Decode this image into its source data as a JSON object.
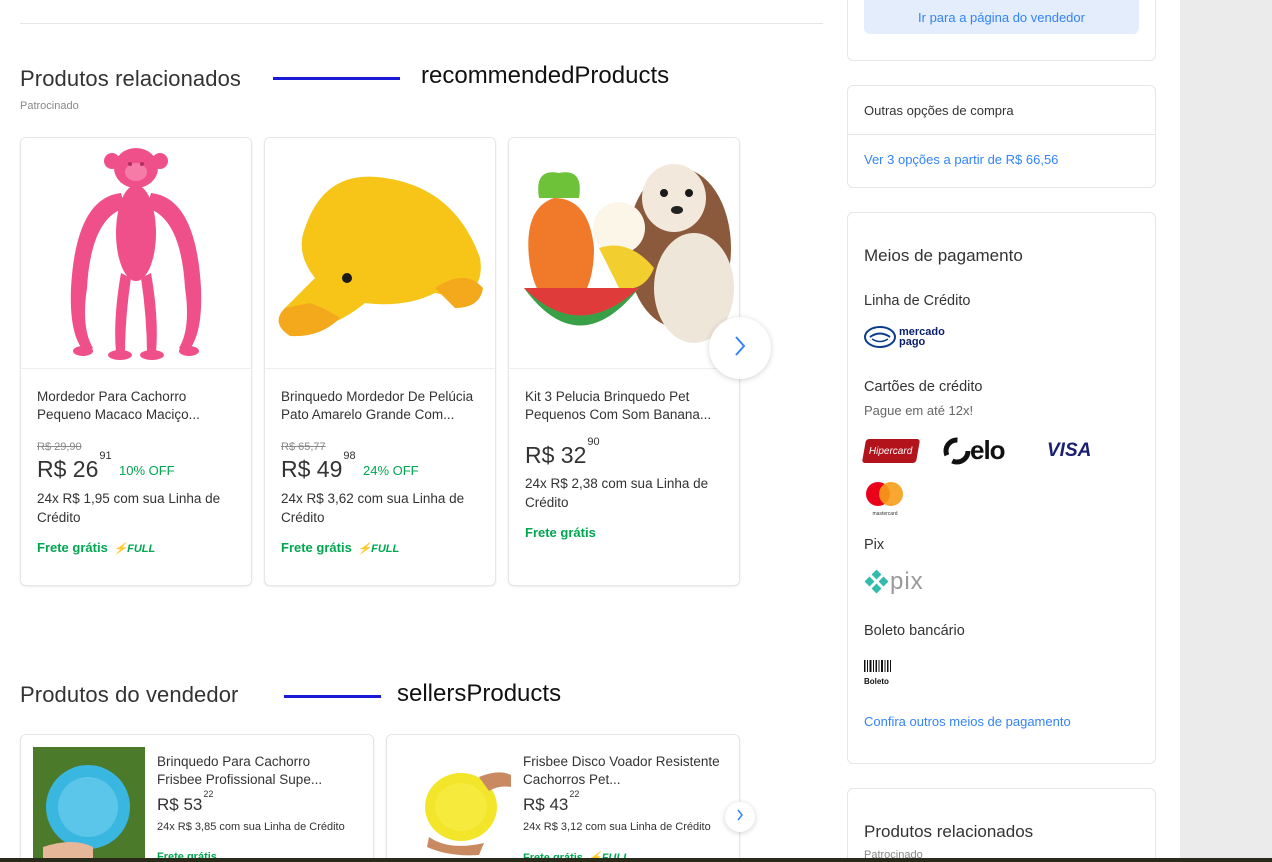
{
  "recommended": {
    "title": "Produtos relacionados",
    "sponsored": "Patrocinado",
    "annotation": "recommendedProducts",
    "cards": [
      {
        "title": "Mordedor Para Cachorro Pequeno Macaco Maciço...",
        "old_price": "R$ 29,90",
        "price_int": "R$ 26",
        "price_cents": "91",
        "discount": "10% OFF",
        "installments": "24x R$ 1,95 com sua Linha de Crédito",
        "shipping": "Frete grátis",
        "full": "FULL"
      },
      {
        "title": "Brinquedo Mordedor De Pelúcia Pato Amarelo Grande Com...",
        "old_price": "R$ 65,77",
        "price_int": "R$ 49",
        "price_cents": "98",
        "discount": "24% OFF",
        "installments": "24x R$ 3,62 com sua Linha de Crédito",
        "shipping": "Frete grátis",
        "full": "FULL"
      },
      {
        "title": "Kit 3 Pelucia Brinquedo Pet Pequenos Com Som Banana...",
        "price_int": "R$ 32",
        "price_cents": "90",
        "installments": "24x R$ 2,38 com sua Linha de Crédito",
        "shipping": "Frete grátis"
      }
    ]
  },
  "seller": {
    "title": "Produtos do vendedor",
    "annotation": "sellersProducts",
    "cards": [
      {
        "title": "Brinquedo Para Cachorro Frisbee Profissional Supe...",
        "price_int": "R$ 53",
        "price_cents": "22",
        "installments": "24x R$ 3,85 com sua Linha de Crédito",
        "shipping": "Frete grátis"
      },
      {
        "title": "Frisbee Disco Voador Resistente Cachorros Pet...",
        "price_int": "R$ 43",
        "price_cents": "22",
        "installments": "24x R$ 3,12 com sua Linha de Crédito",
        "shipping": "Frete grátis",
        "full": "FULL"
      }
    ]
  },
  "sidebar": {
    "seller_button": "Ir para a página do vendedor",
    "other_options": {
      "title": "Outras opções de compra",
      "link": "Ver 3 opções a partir de R$ 66,56"
    },
    "payment": {
      "title": "Meios de pagamento",
      "credit_line": "Linha de Crédito",
      "mercado_pago": "mercado pago",
      "credit_cards": "Cartões de crédito",
      "credit_cards_note": "Pague em até 12x!",
      "hipercard": "Hipercard",
      "elo": "elo",
      "visa": "VISA",
      "mastercard": "mastercard",
      "pix_title": "Pix",
      "pix": "pix",
      "boleto_title": "Boleto bancário",
      "boleto": "Boleto",
      "more_link": "Confira outros meios de pagamento"
    },
    "related": {
      "title": "Produtos relacionados",
      "sponsored": "Patrocinado"
    }
  },
  "colors": {
    "accent": "#3483fa",
    "green": "#00a650",
    "annotation": "#1a1ad6"
  }
}
